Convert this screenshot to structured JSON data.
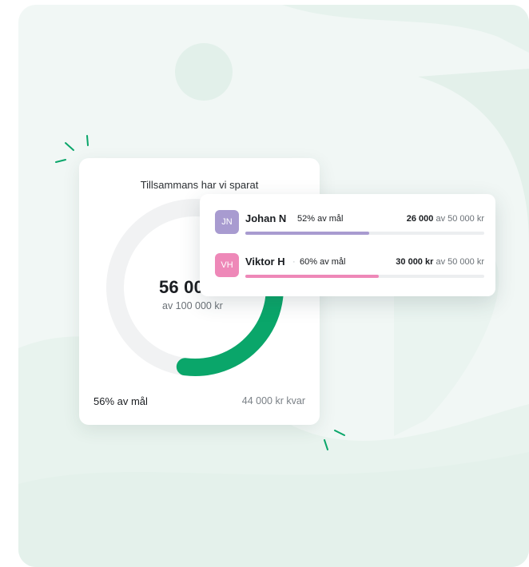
{
  "savings": {
    "title": "Tillsammans har vi sparat",
    "amount": "56 00",
    "amount_sub": "av 100 000 kr",
    "progress_fraction": 0.56,
    "goal_percent_label": "56% av mål",
    "remaining_label": "44 000 kr kvar"
  },
  "members": [
    {
      "initials": "JN",
      "name": "Johan N",
      "separator": "",
      "percent_label": "52% av mål",
      "saved": "26 000",
      "of_goal": "av 50 000 kr",
      "progress_fraction": 0.52,
      "color": "#a89bd0"
    },
    {
      "initials": "VH",
      "name": "Viktor H",
      "separator": "·",
      "percent_label": "60% av mål",
      "saved": "30 000 kr",
      "of_goal": "av 50 000 kr",
      "progress_fraction": 0.56,
      "color": "#ee88b8"
    }
  ],
  "colors": {
    "accent_green": "#0aa66a",
    "track_gray": "#f1f2f3",
    "stage_bg": "#f1f7f5"
  }
}
